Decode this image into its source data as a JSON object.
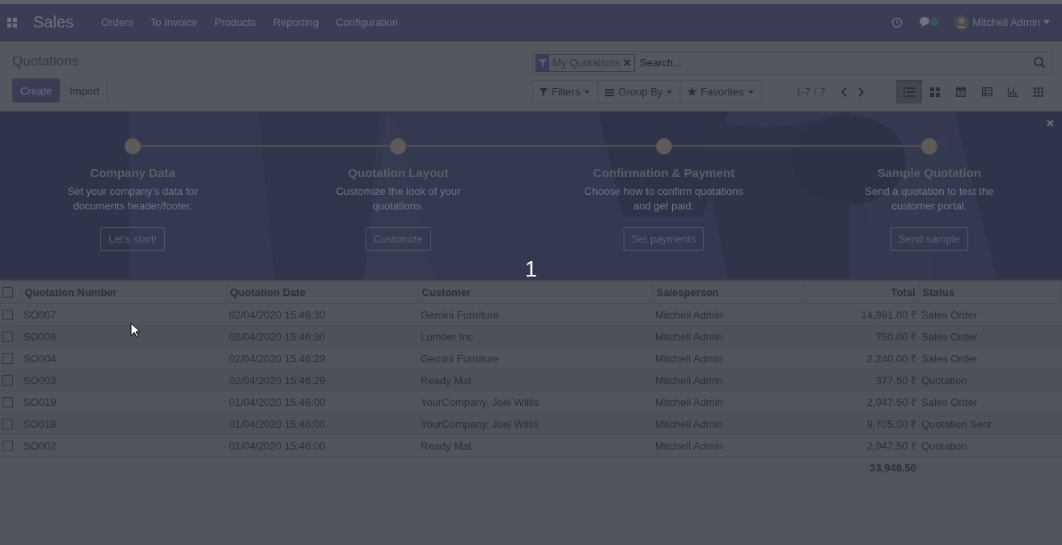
{
  "navbar": {
    "app_name": "Sales",
    "menu": [
      "Orders",
      "To Invoice",
      "Products",
      "Reporting",
      "Configuration"
    ],
    "user": "Mitchell Admin"
  },
  "breadcrumb": "Quotations",
  "buttons": [
    {
      "label": "Create",
      "kind": "primary"
    },
    {
      "label": "Import",
      "kind": "secondary"
    }
  ],
  "search": {
    "facet": "My Quotations",
    "placeholder": "Search..."
  },
  "search_menus": [
    {
      "label": "Filters",
      "kind": "filter"
    },
    {
      "label": "Group By",
      "kind": "group"
    },
    {
      "label": "Favorites",
      "kind": "star"
    }
  ],
  "pager": "1-7 / 7",
  "views": [
    {
      "kind": "list",
      "selected": true
    },
    {
      "kind": "kanban",
      "selected": false
    },
    {
      "kind": "calendar",
      "selected": false
    },
    {
      "kind": "pivot",
      "selected": false
    },
    {
      "kind": "graph",
      "selected": false
    },
    {
      "kind": "activity",
      "selected": false
    }
  ],
  "onboarding": {
    "steps": [
      {
        "title": "Company Data",
        "description": "Set your company's data for documents header/footer.",
        "button": "Let's start!"
      },
      {
        "title": "Quotation Layout",
        "description": "Customize the look of your quotations.",
        "button": "Customize"
      },
      {
        "title": "Confirmation & Payment",
        "description": "Choose how to confirm quotations and get paid.",
        "button": "Set payments"
      },
      {
        "title": "Sample Quotation",
        "description": "Send a quotation to test the customer portal.",
        "button": "Send sample"
      }
    ],
    "tour_step": "1"
  },
  "table": {
    "all_checked": false,
    "columns": [
      "Quotation Number",
      "Quotation Date",
      "Customer",
      "Salesperson",
      "Total",
      "Status"
    ],
    "rows": [
      {
        "checked": false,
        "cells": [
          "SO007",
          "02/04/2020 15:46:30",
          "Gemini Furniture",
          "Mitchell Admin",
          "14,981.00 ₹",
          "Sales Order"
        ]
      },
      {
        "checked": false,
        "cells": [
          "SO006",
          "02/04/2020 15:46:30",
          "Lumber Inc",
          "Mitchell Admin",
          "750.00 ₹",
          "Sales Order"
        ]
      },
      {
        "checked": false,
        "cells": [
          "SO004",
          "02/04/2020 15:46:29",
          "Gemini Furniture",
          "Mitchell Admin",
          "2,240.00 ₹",
          "Sales Order"
        ]
      },
      {
        "checked": false,
        "cells": [
          "SO003",
          "02/04/2020 15:46:29",
          "Ready Mat",
          "Mitchell Admin",
          "377.50 ₹",
          "Quotation"
        ]
      },
      {
        "checked": false,
        "cells": [
          "SO019",
          "01/04/2020 15:46:00",
          "YourCompany, Joel Willis",
          "Mitchell Admin",
          "2,947.50 ₹",
          "Sales Order"
        ]
      },
      {
        "checked": false,
        "cells": [
          "SO018",
          "01/04/2020 15:46:00",
          "YourCompany, Joel Willis",
          "Mitchell Admin",
          "9,705.00 ₹",
          "Quotation Sent"
        ]
      },
      {
        "checked": false,
        "cells": [
          "SO002",
          "01/04/2020 15:46:00",
          "Ready Mat",
          "Mitchell Admin",
          "2,947.50 ₹",
          "Quotation"
        ]
      }
    ],
    "total": "33,948.50"
  }
}
